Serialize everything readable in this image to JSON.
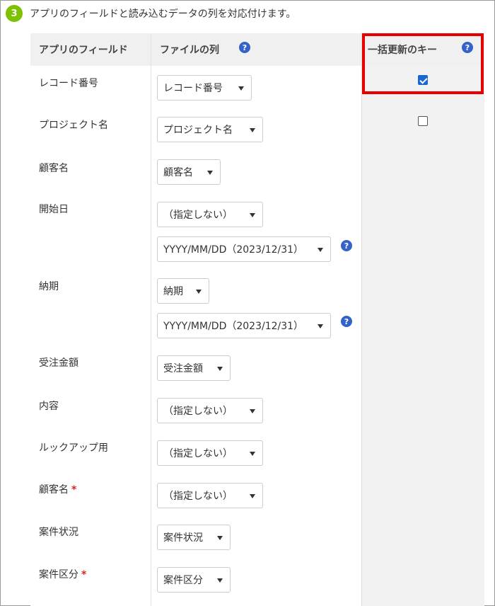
{
  "step": {
    "number": "3",
    "text": "アプリのフィールドと読み込むデータの列を対応付けます。"
  },
  "headers": {
    "field": "アプリのフィールド",
    "file": "ファイルの列",
    "key": "一括更新のキー",
    "help": "?"
  },
  "rows": [
    {
      "label": "レコード番号",
      "required": false,
      "selects": [
        "レコード番号"
      ],
      "key_checkbox": true,
      "key_checked": true
    },
    {
      "label": "プロジェクト名",
      "required": false,
      "selects": [
        "プロジェクト名"
      ],
      "key_checkbox": true,
      "key_checked": false
    },
    {
      "label": "顧客名",
      "required": false,
      "selects": [
        "顧客名"
      ]
    },
    {
      "label": "開始日",
      "required": false,
      "selects": [
        "（指定しない）",
        "YYYY/MM/DD（2023/12/31）"
      ]
    },
    {
      "label": "納期",
      "required": false,
      "selects": [
        "納期",
        "YYYY/MM/DD（2023/12/31）"
      ]
    },
    {
      "label": "受注金額",
      "required": false,
      "selects": [
        "受注金額"
      ]
    },
    {
      "label": "内容",
      "required": false,
      "selects": [
        "（指定しない）"
      ]
    },
    {
      "label": "ルックアップ用",
      "required": false,
      "selects": [
        "（指定しない）"
      ]
    },
    {
      "label": "顧客名",
      "required": true,
      "selects": [
        "（指定しない）"
      ]
    },
    {
      "label": "案件状況",
      "required": false,
      "selects": [
        "案件状況"
      ]
    },
    {
      "label": "案件区分",
      "required": true,
      "selects": [
        "案件区分"
      ]
    }
  ],
  "required_mark": "*",
  "colors": {
    "accent_green": "#7cc200",
    "help_blue": "#3462c9",
    "highlight_red": "#e60000",
    "checkbox_blue": "#1967d2"
  }
}
